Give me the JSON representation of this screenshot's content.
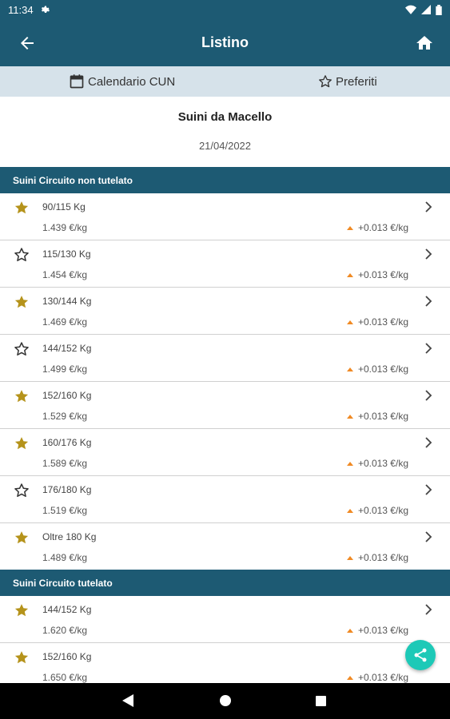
{
  "status": {
    "time": "11:34"
  },
  "app_bar": {
    "title": "Listino"
  },
  "tabs": [
    {
      "label": "Calendario CUN",
      "icon": "calendar-icon"
    },
    {
      "label": "Preferiti",
      "icon": "star-outline-icon"
    }
  ],
  "header": {
    "title": "Suini da Macello",
    "date": "21/04/2022"
  },
  "sections": [
    {
      "title": "Suini Circuito non tutelato",
      "items": [
        {
          "name": "90/115 Kg",
          "price": "1.439 €/kg",
          "variation": "+0.013 €/kg",
          "favorite": true
        },
        {
          "name": "115/130 Kg",
          "price": "1.454 €/kg",
          "variation": "+0.013 €/kg",
          "favorite": false
        },
        {
          "name": "130/144 Kg",
          "price": "1.469 €/kg",
          "variation": "+0.013 €/kg",
          "favorite": true
        },
        {
          "name": "144/152 Kg",
          "price": "1.499 €/kg",
          "variation": "+0.013 €/kg",
          "favorite": false
        },
        {
          "name": "152/160 Kg",
          "price": "1.529 €/kg",
          "variation": "+0.013 €/kg",
          "favorite": true
        },
        {
          "name": "160/176 Kg",
          "price": "1.589 €/kg",
          "variation": "+0.013 €/kg",
          "favorite": true
        },
        {
          "name": "176/180 Kg",
          "price": "1.519 €/kg",
          "variation": "+0.013 €/kg",
          "favorite": false
        },
        {
          "name": "Oltre 180 Kg",
          "price": "1.489 €/kg",
          "variation": "+0.013 €/kg",
          "favorite": true
        }
      ]
    },
    {
      "title": "Suini Circuito tutelato",
      "items": [
        {
          "name": "144/152 Kg",
          "price": "1.620 €/kg",
          "variation": "+0.013 €/kg",
          "favorite": true
        },
        {
          "name": "152/160 Kg",
          "price": "1.650 €/kg",
          "variation": "+0.013 €/kg",
          "favorite": true
        }
      ]
    }
  ],
  "colors": {
    "primary": "#1d5a73",
    "tab_bg": "#d6e2ea",
    "star": "#b5931b",
    "up": "#f08a24",
    "fab": "#1dc9b7"
  }
}
